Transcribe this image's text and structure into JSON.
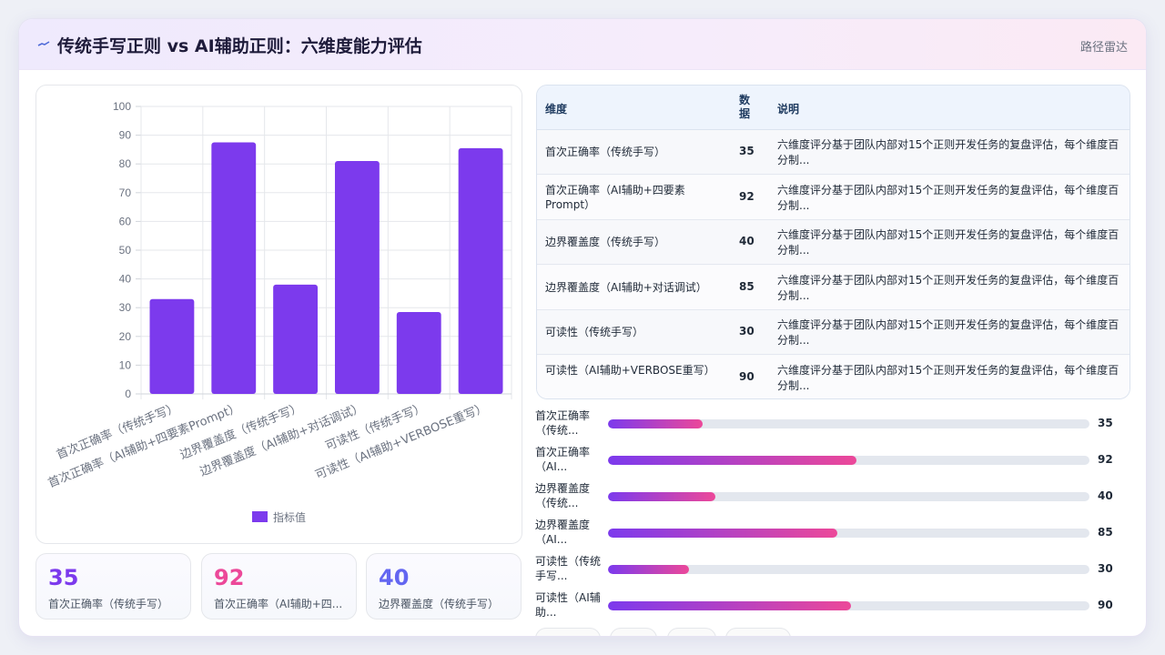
{
  "header": {
    "title": "传统手写正则 vs AI辅助正则：六维度能力评估",
    "icon": "chart-line-icon",
    "link_label": "路径雷达"
  },
  "colors": {
    "bar": "#7c3aed",
    "accent_purple": "#7c3aed",
    "accent_pink": "#ec4899",
    "accent_indigo": "#6366f1"
  },
  "chart_data": {
    "type": "bar",
    "categories": [
      "首次正确率（传统手写）",
      "首次正确率（AI辅助+四要素Prompt）",
      "边界覆盖度（传统手写）",
      "边界覆盖度（AI辅助+对话调试）",
      "可读性（传统手写）",
      "可读性（AI辅助+VERBOSE重写）"
    ],
    "series": [
      {
        "name": "指标值",
        "values": [
          33,
          87.5,
          38,
          81,
          28.5,
          85.5
        ]
      }
    ],
    "ylim": [
      0,
      100
    ],
    "yticks": [
      0,
      10,
      20,
      30,
      40,
      50,
      60,
      70,
      80,
      90,
      100
    ],
    "grid": true,
    "legend": "bottom"
  },
  "table": {
    "headers": [
      "维度",
      "数据",
      "说明"
    ],
    "rows": [
      {
        "dim": "首次正确率（传统手写）",
        "value": "35",
        "desc": "六维度评分基于团队内部对15个正则开发任务的复盘评估，每个维度百分制..."
      },
      {
        "dim": "首次正确率（AI辅助+四要素Prompt）",
        "value": "92",
        "desc": "六维度评分基于团队内部对15个正则开发任务的复盘评估，每个维度百分制..."
      },
      {
        "dim": "边界覆盖度（传统手写）",
        "value": "40",
        "desc": "六维度评分基于团队内部对15个正则开发任务的复盘评估，每个维度百分制..."
      },
      {
        "dim": "边界覆盖度（AI辅助+对话调试）",
        "value": "85",
        "desc": "六维度评分基于团队内部对15个正则开发任务的复盘评估，每个维度百分制..."
      },
      {
        "dim": "可读性（传统手写）",
        "value": "30",
        "desc": "六维度评分基于团队内部对15个正则开发任务的复盘评估，每个维度百分制..."
      },
      {
        "dim": "可读性（AI辅助+VERBOSE重写）",
        "value": "90",
        "desc": "六维度评分基于团队内部对15个正则开发任务的复盘评估，每个维度百分制..."
      }
    ]
  },
  "progress": [
    {
      "label": "首次正确率（传统...",
      "value": 35,
      "display": "35"
    },
    {
      "label": "首次正确率（AI...",
      "value": 92,
      "display": "92"
    },
    {
      "label": "边界覆盖度（传统...",
      "value": 40,
      "display": "40"
    },
    {
      "label": "边界覆盖度（AI...",
      "value": 85,
      "display": "85"
    },
    {
      "label": "可读性（传统手写...",
      "value": 30,
      "display": "30"
    },
    {
      "label": "可读性（AI辅助...",
      "value": 90,
      "display": "90"
    }
  ],
  "stats": [
    {
      "value": "35",
      "label": "首次正确率（传统手写）",
      "color": "#7c3aed"
    },
    {
      "value": "92",
      "label": "首次正确率（AI辅助+四...",
      "color": "#ec4899"
    },
    {
      "value": "40",
      "label": "边界覆盖度（传统手写）",
      "color": "#6366f1"
    }
  ]
}
